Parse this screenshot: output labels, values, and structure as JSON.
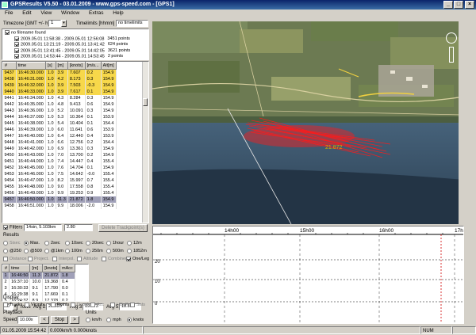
{
  "app": {
    "title": "GPSResults V5.50 - 03.01.2009 - www.gps-speed.com - [GPS1]",
    "min_icon": "_",
    "max_icon": "□",
    "close_icon": "×"
  },
  "menu": [
    "File",
    "Edit",
    "View",
    "Window",
    "Extras",
    "Help"
  ],
  "timezone": {
    "label": "Timezone [GMT +/- h]",
    "value": "1",
    "timelimits_label": "Timelimits [hhmm]",
    "no_timelimits": "no timelimits"
  },
  "files": [
    {
      "name": "no filename found",
      "checked": true,
      "indent": 0
    },
    {
      "name": "2009.05.01 11:58:38 - 2009.05.01 12:56:08",
      "points": "3451 points",
      "checked": true,
      "indent": 1
    },
    {
      "name": "2009.05.01 13:21:19 - 2009.05.01 13:41:42",
      "points": "624 points",
      "checked": true,
      "indent": 1
    },
    {
      "name": "2009.05.01 13:41:45 - 2009.05.01 14:42:05",
      "points": "3621 points",
      "checked": true,
      "indent": 1
    },
    {
      "name": "2009.05.01 14:53:44 - 2009.05.01 14:53:45",
      "points": "2 points",
      "checked": true,
      "indent": 1
    }
  ],
  "points_table": {
    "headers": [
      "#",
      "time",
      "[s]",
      "[m]",
      "[knots]",
      "[m/s...",
      "Alt[m]"
    ],
    "rows": [
      {
        "c": [
          "9437",
          "16:46:30.000",
          "1.0",
          "3.9",
          "7.607",
          "0.2",
          "154.9"
        ],
        "hl": true
      },
      {
        "c": [
          "9438",
          "16:46:31.000",
          "1.0",
          "4.2",
          "8.173",
          "0.3",
          "154.9"
        ],
        "hl": true
      },
      {
        "c": [
          "9439",
          "16:46:32.000",
          "1.0",
          "3.9",
          "7.503",
          "-0.3",
          "154.9"
        ],
        "hl": true
      },
      {
        "c": [
          "9440",
          "16:46:33.000",
          "1.0",
          "3.9",
          "7.617",
          "0.1",
          "154.9"
        ],
        "hl": true
      },
      {
        "c": [
          "9441",
          "16:46:34.000",
          "1.0",
          "4.3",
          "8.284",
          "0.3",
          "154.9"
        ]
      },
      {
        "c": [
          "9442",
          "16:46:35.000",
          "1.0",
          "4.8",
          "9.413",
          "0.6",
          "154.9"
        ]
      },
      {
        "c": [
          "9443",
          "16:46:36.000",
          "1.0",
          "5.2",
          "10.091",
          "0.3",
          "154.9"
        ]
      },
      {
        "c": [
          "9444",
          "16:46:37.000",
          "1.0",
          "5.3",
          "10.364",
          "0.1",
          "153.9"
        ]
      },
      {
        "c": [
          "9445",
          "16:46:38.000",
          "1.0",
          "5.4",
          "10.404",
          "0.1",
          "154.4"
        ]
      },
      {
        "c": [
          "9446",
          "16:46:39.000",
          "1.0",
          "6.0",
          "11.641",
          "0.6",
          "153.9"
        ]
      },
      {
        "c": [
          "9447",
          "16:46:40.000",
          "1.0",
          "6.4",
          "12.440",
          "0.4",
          "153.9"
        ]
      },
      {
        "c": [
          "9448",
          "16:46:41.000",
          "1.0",
          "6.6",
          "12.756",
          "0.2",
          "154.4"
        ]
      },
      {
        "c": [
          "9449",
          "16:46:42.000",
          "1.0",
          "6.9",
          "13.361",
          "0.3",
          "154.9"
        ]
      },
      {
        "c": [
          "9450",
          "16:46:43.000",
          "1.0",
          "7.0",
          "13.700",
          "0.2",
          "154.9"
        ]
      },
      {
        "c": [
          "9451",
          "16:46:44.000",
          "1.0",
          "7.4",
          "14.447",
          "0.4",
          "155.4"
        ]
      },
      {
        "c": [
          "9452",
          "16:46:45.000",
          "1.0",
          "7.6",
          "14.704",
          "0.1",
          "154.9"
        ]
      },
      {
        "c": [
          "9453",
          "16:46:46.000",
          "1.0",
          "7.5",
          "14.642",
          "-0.0",
          "155.4"
        ]
      },
      {
        "c": [
          "9454",
          "16:46:47.000",
          "1.0",
          "8.2",
          "15.997",
          "0.7",
          "155.4"
        ]
      },
      {
        "c": [
          "9455",
          "16:46:48.000",
          "1.0",
          "9.0",
          "17.558",
          "0.8",
          "155.4"
        ]
      },
      {
        "c": [
          "9456",
          "16:46:49.000",
          "1.0",
          "9.9",
          "19.253",
          "0.9",
          "155.4"
        ]
      },
      {
        "c": [
          "9457",
          "16:46:50.000",
          "1.0",
          "11.3",
          "21.872",
          "1.8",
          "154.9"
        ],
        "sel": true
      },
      {
        "c": [
          "9458",
          "16:46:51.000",
          "1.0",
          "9.9",
          "18.006",
          "-2.0",
          "154.9"
        ]
      }
    ]
  },
  "filters": {
    "label": "Filters",
    "value": "14sin, 5.103km",
    "speed": "2.80",
    "delete_btn": "Delete Trackpoint(s)"
  },
  "results": {
    "label": "Results",
    "row1": [
      {
        "t": "Sisec",
        "on": false,
        "gray": true
      },
      {
        "t": "Max.",
        "on": true
      },
      {
        "t": "2sec",
        "on": false
      },
      {
        "t": "10sec",
        "on": false
      },
      {
        "t": "20sec",
        "on": false
      },
      {
        "t": "1hour",
        "on": false
      },
      {
        "t": "12m",
        "on": false
      }
    ],
    "row2": [
      {
        "t": "@250",
        "on": false
      },
      {
        "t": "@500",
        "on": false
      },
      {
        "t": "@1km",
        "on": false
      },
      {
        "t": "100m",
        "on": false
      },
      {
        "t": "250m",
        "on": false
      },
      {
        "t": "500m",
        "on": false
      },
      {
        "t": "1852m",
        "on": false
      }
    ],
    "row3": [
      {
        "t": "Distance",
        "gray": true
      },
      {
        "t": "Project.",
        "gray": true
      },
      {
        "t": "Interpol.",
        "gray": true
      },
      {
        "t": "Altitude",
        "gray": true
      },
      {
        "t": "Combined",
        "gray": true
      },
      {
        "t": "One/Leg",
        "on": true
      }
    ]
  },
  "results_table": {
    "headers": [
      "#",
      "time",
      "[m]",
      "[knots]",
      "mAcc"
    ],
    "rows": [
      [
        "1",
        "16:46:50",
        "11.3",
        "21.872",
        "1.8"
      ],
      [
        "2",
        "16:37:10",
        "10.0",
        "19.368",
        "0.4"
      ],
      [
        "3",
        "16:30:33",
        "9.1",
        "17.790",
        "0.0"
      ],
      [
        "4",
        "16:29:38",
        "9.1",
        "17.669",
        "0.1"
      ],
      [
        "5",
        "16:24:37",
        "8.9",
        "17.378",
        "0.2"
      ]
    ]
  },
  "averages": {
    "rows_count": "50",
    "rows_label": "rows",
    "avg2_label": "Avg 2:",
    "avg2": "20.620",
    "avg3_label": "Avg 3:",
    "avg3": "19.673",
    "avg5_label": "Avg 5:",
    "avg5": "18.813"
  },
  "display": {
    "label": "Display",
    "items": [
      "Tracks",
      "Vicinity",
      "Points",
      "Doppler",
      "Acc",
      "HDoP",
      "Sats"
    ],
    "checked": [
      false,
      false,
      false,
      false,
      false,
      false,
      false
    ]
  },
  "playback": {
    "label": "Playback",
    "speed_label": "Speed:",
    "speed": "10.00x",
    "stop": "Stop",
    "prev": "<",
    "next": ">"
  },
  "units": {
    "label": "Units",
    "options": [
      "km/h",
      "mph",
      "knots"
    ],
    "selected": 2
  },
  "timeline": {
    "ticks": [
      "14h00",
      "15h00",
      "16h00",
      "17h00"
    ],
    "lane_labels": [
      "20",
      "10",
      "0"
    ]
  },
  "map": {
    "speed_label": "21.872"
  },
  "status": {
    "date": "01.05.2009 15:54:42",
    "speed": "0.000km/h 0.000knots",
    "num": "NUM"
  }
}
